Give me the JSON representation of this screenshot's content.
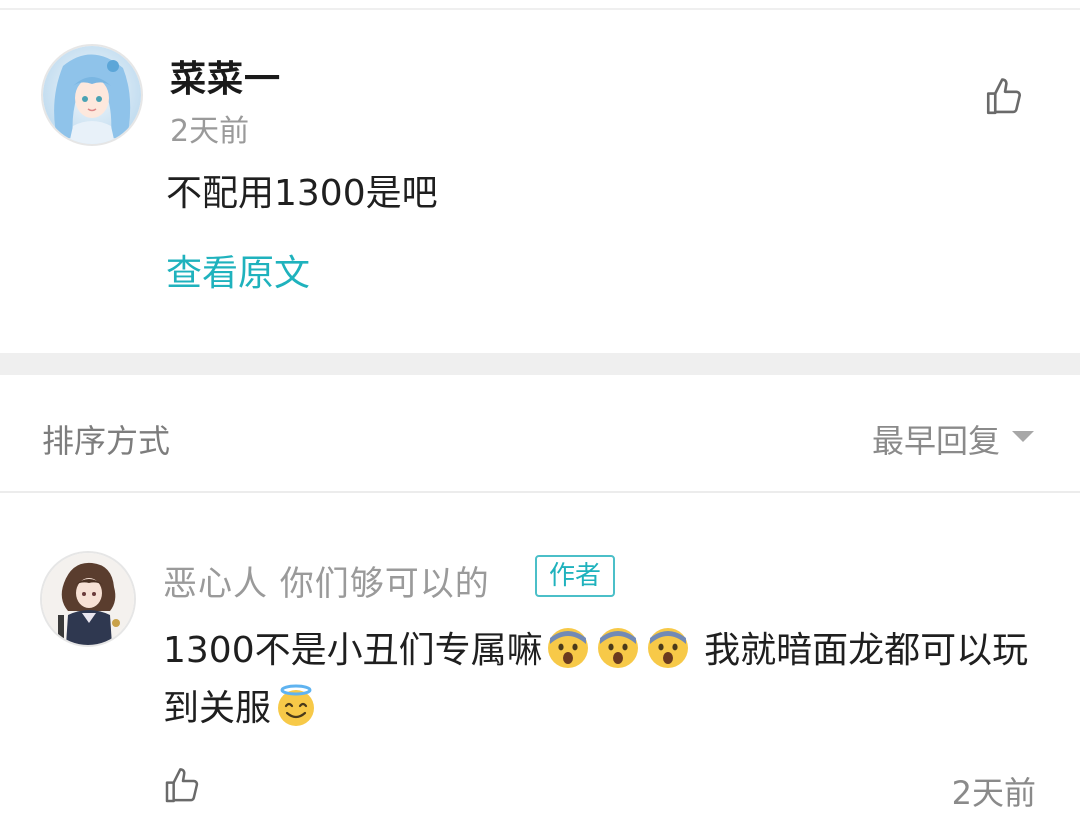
{
  "main_comment": {
    "username": "菜菜一",
    "time": "2天前",
    "text": "不配用1300是吧",
    "view_original": "查看原文"
  },
  "sort": {
    "label": "排序方式",
    "value": "最早回复"
  },
  "reply": {
    "username": "恶心人 你们够可以的",
    "badge": "作者",
    "text_part1": "1300不是小丑们专属嘛",
    "text_part2": " 我就暗面龙都可以玩到关服",
    "emojis": [
      "fearful-face-emoji",
      "fearful-face-emoji",
      "fearful-face-emoji",
      "smiling-face-with-halo-emoji"
    ],
    "time": "2天前"
  },
  "colors": {
    "accent": "#1fb2bd",
    "muted": "#9a9a9a",
    "band": "#efefef"
  }
}
